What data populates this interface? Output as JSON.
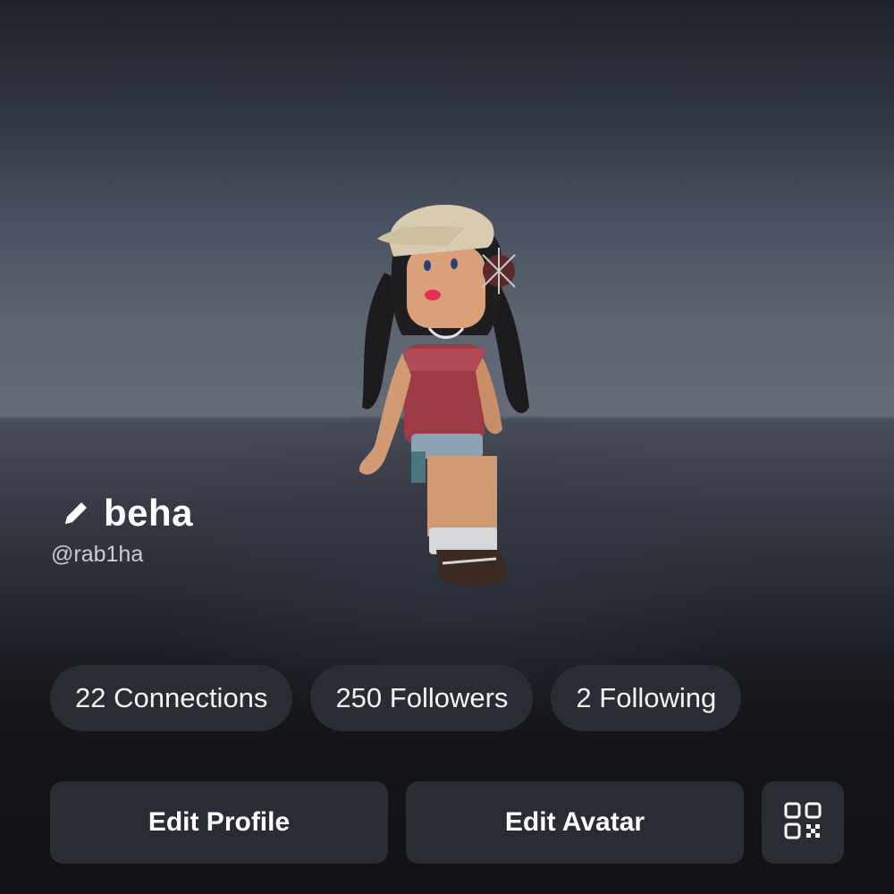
{
  "profile": {
    "display_name": "beha",
    "username": "@rab1ha"
  },
  "stats": {
    "connections": "22 Connections",
    "followers": "250 Followers",
    "following": "2 Following"
  },
  "actions": {
    "edit_profile": "Edit Profile",
    "edit_avatar": "Edit Avatar",
    "qr_icon": "qr-code-icon"
  },
  "icons": {
    "edit_name": "pencil-icon"
  },
  "colors": {
    "pill_bg": "#2a2c33",
    "button_bg": "#2a2c33",
    "background": "#111216",
    "text_primary": "#ffffff",
    "text_secondary": "#c9ccd3"
  }
}
